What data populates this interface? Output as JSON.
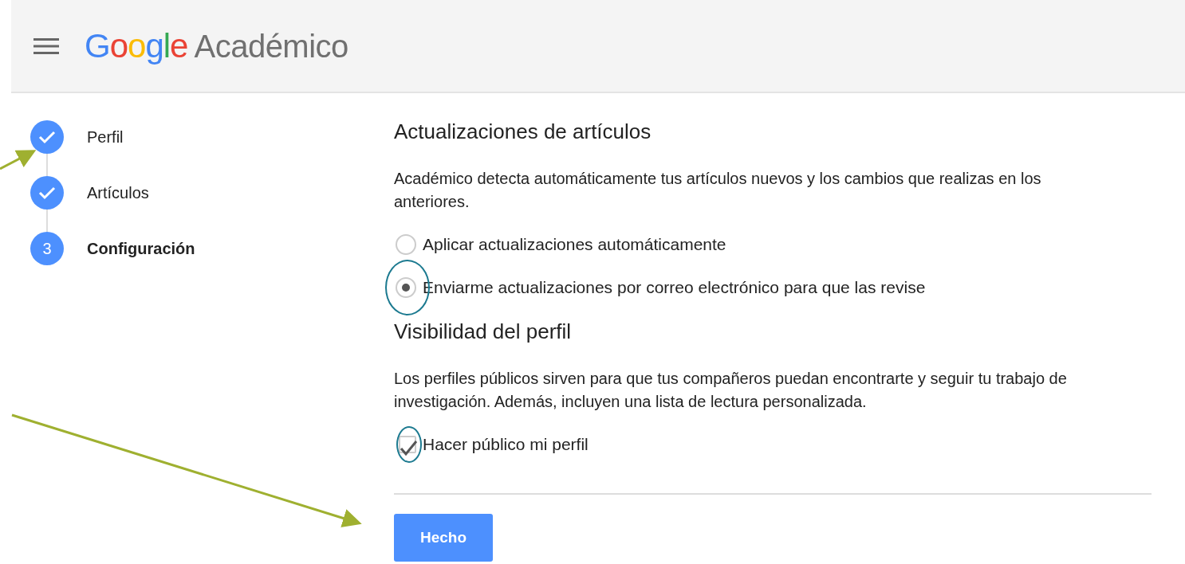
{
  "header": {
    "logo": "Google",
    "product": "Académico"
  },
  "steps": [
    {
      "label": "Perfil",
      "kind": "done"
    },
    {
      "label": "Artículos",
      "kind": "done"
    },
    {
      "label": "Configuración",
      "kind": "current",
      "number": "3"
    }
  ],
  "updates": {
    "title": "Actualizaciones de artículos",
    "description": "Académico detecta automáticamente tus artículos nuevos y los cambios que realizas en los anteriores.",
    "options": [
      {
        "label": "Aplicar actualizaciones automáticamente",
        "selected": false
      },
      {
        "label": "Enviarme actualizaciones por correo electrónico para que las revise",
        "selected": true
      }
    ]
  },
  "visibility": {
    "title": "Visibilidad del perfil",
    "description": "Los perfiles públicos sirven para que tus compañeros puedan encontrarte y seguir tu trabajo de investigación. Además, incluyen una lista de lectura personalizada.",
    "checkbox": {
      "label": "Hacer público mi perfil",
      "checked": true
    }
  },
  "button": "Hecho"
}
